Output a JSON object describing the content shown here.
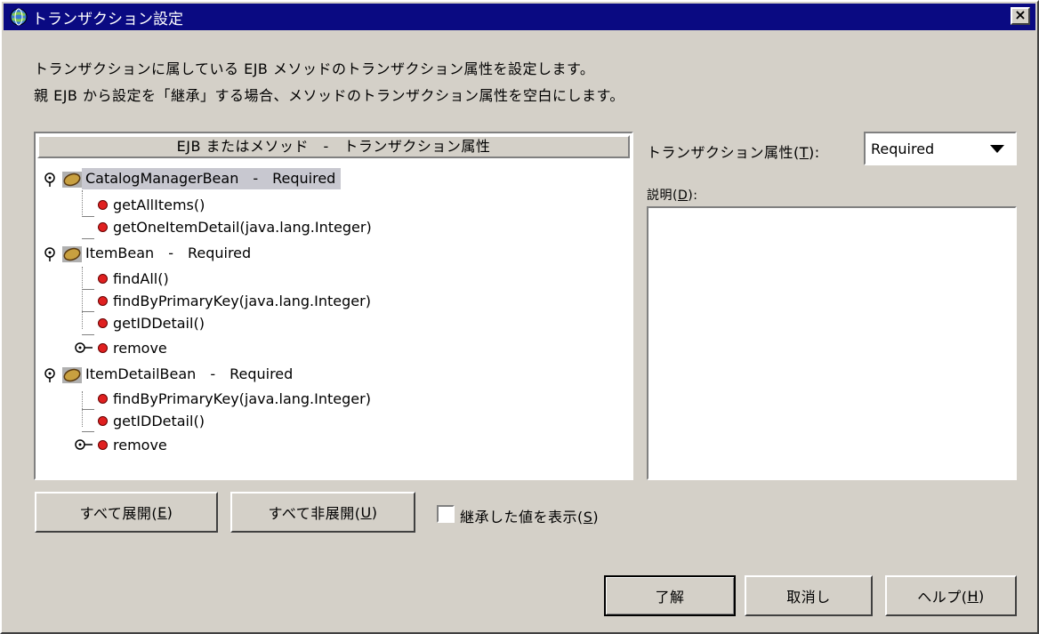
{
  "window": {
    "title": "トランザクション設定",
    "close_label": "×"
  },
  "description": {
    "line1": "トランザクションに属している EJB メソッドのトランザクション属性を設定します。",
    "line2": "親 EJB から設定を「継承」する場合、メソッドのトランザクション属性を空白にします。"
  },
  "tree": {
    "header": "EJB またはメソッド　-　トランザクション属性",
    "beans": [
      {
        "name": "CatalogManagerBean　-　Required",
        "methods": [
          "getAllItems()",
          "getOneItemDetail(java.lang.Integer)"
        ]
      },
      {
        "name": "ItemBean　-　Required",
        "methods": [
          "findAll()",
          "findByPrimaryKey(java.lang.Integer)",
          "getIDDetail()",
          "remove"
        ]
      },
      {
        "name": "ItemDetailBean　-　Required",
        "methods": [
          "findByPrimaryKey(java.lang.Integer)",
          "getIDDetail()",
          "remove"
        ]
      }
    ]
  },
  "attribute": {
    "label": "トランザクション属性(",
    "mnemonic": "T",
    "label_end": "):",
    "value": "Required"
  },
  "explanation": {
    "label": "説明(",
    "mnemonic": "D",
    "label_end": "):"
  },
  "buttons": {
    "expand_all": "すべて展開(",
    "expand_all_key": "E",
    "collapse_all": "すべて非展開(",
    "collapse_all_key": "U",
    "show_inherited": "継承した値を表示(",
    "show_inherited_key": "S",
    "ok": "了解",
    "cancel": "取消し",
    "help": "ヘルプ(",
    "help_key": "H",
    "close_paren": ")"
  },
  "colors": {
    "titlebar": "#0a0a82",
    "background": "#d4d0c8",
    "method_dot": "#e02020",
    "selection": "#c8c8d0"
  }
}
